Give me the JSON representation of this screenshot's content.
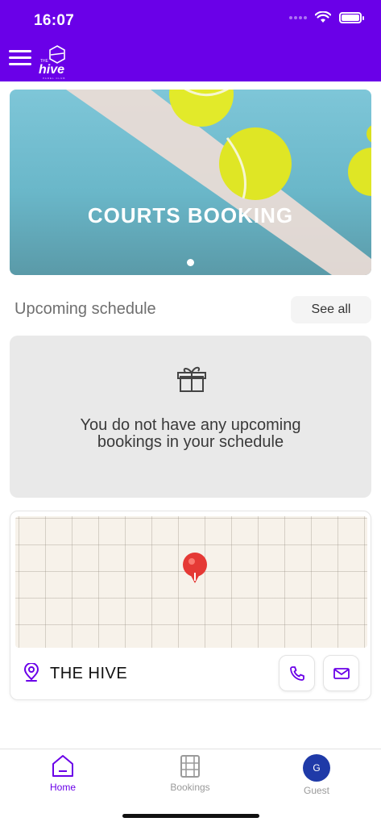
{
  "status_bar": {
    "time": "16:07"
  },
  "header": {
    "logo_the": "THE",
    "logo_text": "hive",
    "logo_sub": "PADEL CLUB"
  },
  "banner": {
    "title": "COURTS BOOKING"
  },
  "upcoming": {
    "title": "Upcoming schedule",
    "see_all": "See all",
    "empty_line1": "You do not have any upcoming",
    "empty_line2": "bookings in your schedule"
  },
  "location": {
    "name": "THE HIVE"
  },
  "bottom_nav": {
    "home": "Home",
    "bookings": "Bookings",
    "guest": "Guest",
    "avatar_initial": "G"
  },
  "colors": {
    "brand": "#6a00e8",
    "avatar": "#1f3aa8",
    "pin": "#e53935"
  }
}
